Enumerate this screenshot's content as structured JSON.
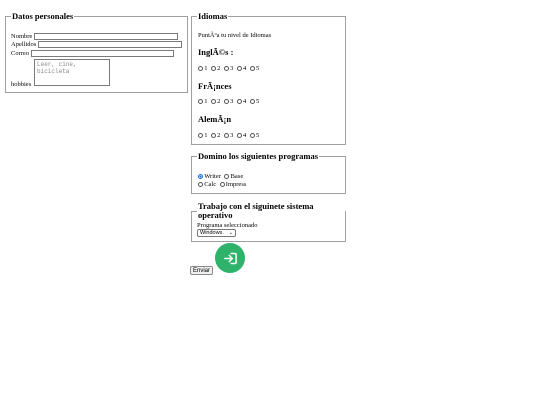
{
  "personal": {
    "legend": "Datos personales",
    "nombre_label": "Nombre",
    "apellidos_label": "Apellidos",
    "correo_label": "Correo",
    "hobbies_label": "hobbies",
    "hobbies_placeholder": "Leer, cine, bicicleta",
    "nombre_value": "",
    "apellidos_value": "",
    "correo_value": ""
  },
  "idiomas": {
    "legend": "Idiomas",
    "intro": "PuntÃºa tu nivel de Idiomas",
    "languages": [
      {
        "name": "InglÃ©s :",
        "options": [
          "1",
          "2",
          "3",
          "4",
          "5"
        ]
      },
      {
        "name": "FrÃ¡nces",
        "options": [
          "1",
          "2",
          "3",
          "4",
          "5"
        ]
      },
      {
        "name": "AlemÃ¡n",
        "options": [
          "1",
          "2",
          "3",
          "4",
          "5"
        ]
      }
    ]
  },
  "programas": {
    "legend": "Domino los siguientes programas",
    "options": [
      "Writer",
      "Base",
      "Calc",
      "Impress"
    ],
    "selected": "Writer"
  },
  "sistema": {
    "legend": "Trabajo con el siguinete sistema operativo",
    "label": "Programa seleccionado",
    "selected_value": "Windows."
  },
  "submit_label": "Enviar",
  "fab": {
    "icon": "login-arrow-icon",
    "color": "#2fb36b"
  },
  "colors": {
    "radio_selected": "#1a73e8"
  }
}
